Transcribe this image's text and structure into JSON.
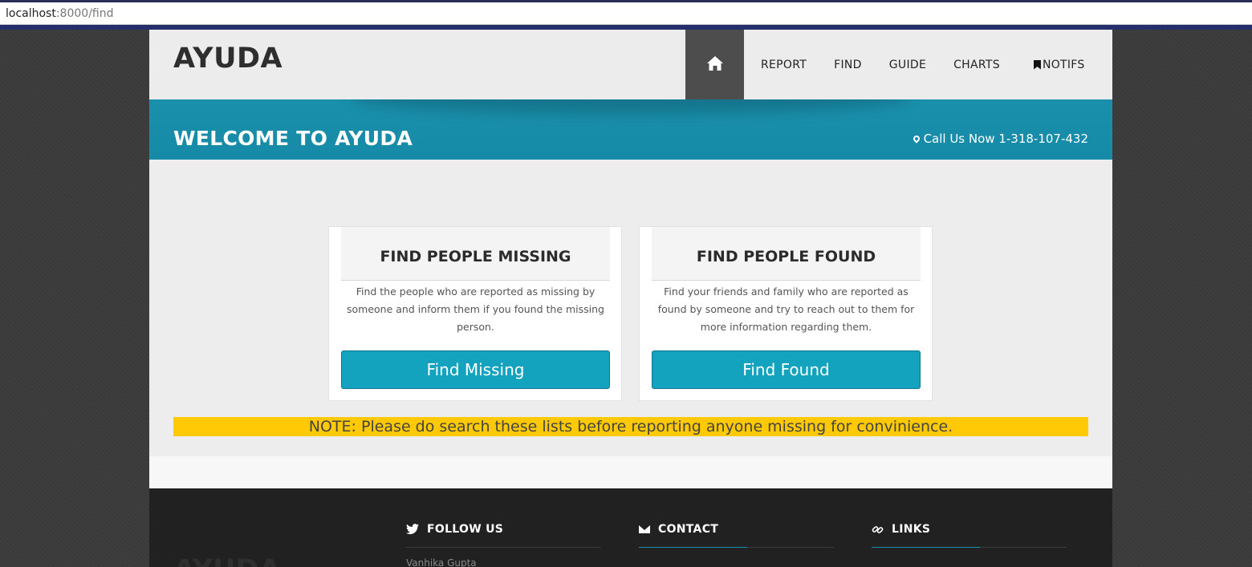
{
  "browser": {
    "host": "localhost",
    "path": ":8000/find"
  },
  "header": {
    "logo": "AYUDA",
    "nav": [
      {
        "label": "REPORT"
      },
      {
        "label": "FIND"
      },
      {
        "label": "GUIDE"
      },
      {
        "label": "CHARTS"
      },
      {
        "label": "NOTIFS"
      }
    ],
    "home_icon": "home-icon",
    "notifs_icon": "bookmark-icon"
  },
  "banner": {
    "title": "WELCOME TO AYUDA",
    "phone": "Call Us Now 1-318-107-432",
    "phone_icon": "map-marker-icon"
  },
  "cards": [
    {
      "title": "FIND PEOPLE MISSING",
      "text_lines": [
        "Find the people who are reported as missing by",
        "someone and inform them if you found the missing",
        "person."
      ],
      "button": "Find Missing"
    },
    {
      "title": "FIND PEOPLE FOUND",
      "text_lines": [
        "Find your friends and family who are reported as",
        "found by someone and try to reach out to them for",
        "more information regarding them."
      ],
      "button": "Find Found"
    }
  ],
  "note": "NOTE: Please do search these lists before reporting anyone missing for convinience.",
  "footer": {
    "logo": "AYUDA",
    "follow": {
      "title": "FOLLOW US",
      "icon": "twitter-icon",
      "sub": "Vanhika Gupta"
    },
    "contact": {
      "title": "CONTACT",
      "icon": "envelope-icon"
    },
    "links": {
      "title": "LINKS",
      "icon": "link-icon"
    }
  },
  "colors": {
    "banner": "#1a90ad",
    "button": "#13a3bf",
    "note_bg": "#ffc906",
    "nav_active": "#4d4d4d",
    "footer": "#212121"
  }
}
